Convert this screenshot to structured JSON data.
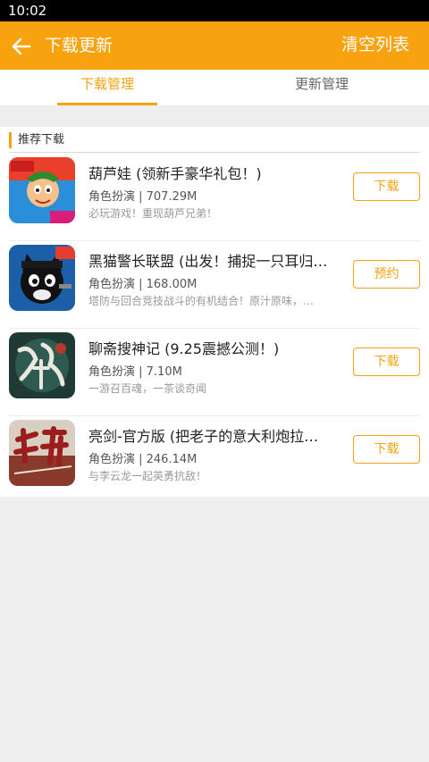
{
  "status_bar": {
    "time": "10:02"
  },
  "header": {
    "title": "下载更新",
    "clear_label": "清空列表",
    "back_icon": "arrow-left-icon"
  },
  "tabs": [
    {
      "label": "下载管理",
      "active": true
    },
    {
      "label": "更新管理",
      "active": false
    }
  ],
  "section": {
    "title": "推荐下载"
  },
  "apps": [
    {
      "name": "葫芦娃 (领新手豪华礼包！)",
      "category": "角色扮演",
      "size": "707.29M",
      "meta": "角色扮演 | 707.29M",
      "description": "必玩游戏！重现葫芦兄弟！",
      "button": "下载"
    },
    {
      "name": "黑猫警长联盟 (出发！捕捉一只耳归…",
      "category": "角色扮演",
      "size": "168.00M",
      "meta": "角色扮演 | 168.00M",
      "description": "塔防与回合竞技战斗的有机结合！原汁原味，…",
      "button": "预约"
    },
    {
      "name": "聊斋搜神记 (9.25震撼公测！)",
      "category": "角色扮演",
      "size": "7.10M",
      "meta": "角色扮演 | 7.10M",
      "description": "一游召百魂，一茶谈奇闻",
      "button": "下载"
    },
    {
      "name": "亮剑-官方版 (把老子的意大利炮拉…",
      "category": "角色扮演",
      "size": "246.14M",
      "meta": "角色扮演 | 246.14M",
      "description": "与李云龙一起英勇抗敌！",
      "button": "下载"
    }
  ],
  "colors": {
    "accent": "#f7a20e",
    "status_bar": "#000000",
    "background": "#eeeeee"
  }
}
